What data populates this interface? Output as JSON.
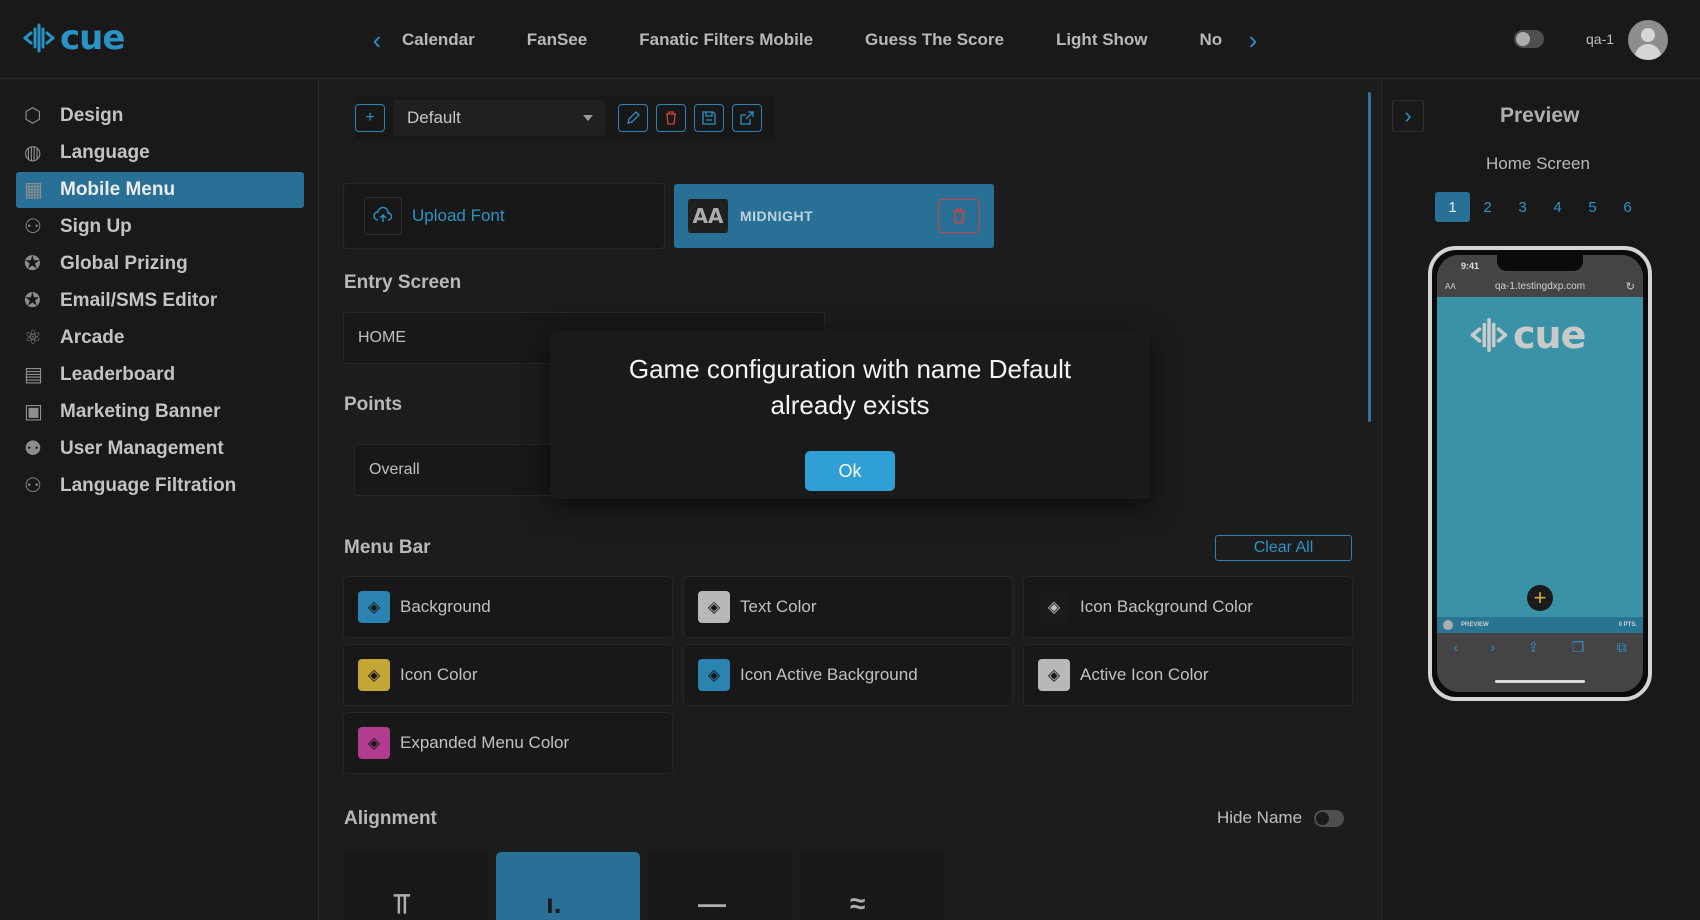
{
  "app": {
    "logo_text": "cue",
    "user_name": "qa-1"
  },
  "top_tabs": [
    "Calendar",
    "FanSee",
    "Fanatic Filters Mobile",
    "Guess The Score",
    "Light Show",
    "No"
  ],
  "sidebar": {
    "items": [
      {
        "label": "Design",
        "icon": "cube-icon"
      },
      {
        "label": "Language",
        "icon": "globe-icon"
      },
      {
        "label": "Mobile Menu",
        "icon": "grid-icon"
      },
      {
        "label": "Sign Up",
        "icon": "user-plus-icon"
      },
      {
        "label": "Global Prizing",
        "icon": "award-icon"
      },
      {
        "label": "Email/SMS Editor",
        "icon": "award-icon"
      },
      {
        "label": "Arcade",
        "icon": "atom-icon"
      },
      {
        "label": "Leaderboard",
        "icon": "chart-icon"
      },
      {
        "label": "Marketing Banner",
        "icon": "banner-icon"
      },
      {
        "label": "User Management",
        "icon": "users-icon"
      },
      {
        "label": "Language Filtration",
        "icon": "user-filter-icon"
      }
    ],
    "active_index": 2
  },
  "toolbar": {
    "config_select_value": "Default"
  },
  "fonts": {
    "upload_label": "Upload Font",
    "current_font_badge": "AA",
    "current_font_name": "MIDNIGHT"
  },
  "entry_screen": {
    "label": "Entry Screen",
    "value": "HOME"
  },
  "points": {
    "label": "Points",
    "value": "Overall"
  },
  "menu_bar": {
    "label": "Menu Bar",
    "clear_all": "Clear All",
    "colors": [
      {
        "label": "Background",
        "swatch": "#2f8fc0"
      },
      {
        "label": "Text Color",
        "swatch": "#c8c8c8"
      },
      {
        "label": "Icon Background Color",
        "swatch": "#1d1d1d"
      },
      {
        "label": "Icon Color",
        "swatch": "#d4b53a"
      },
      {
        "label": "Icon Active Background",
        "swatch": "#2f8fc0"
      },
      {
        "label": "Active Icon Color",
        "swatch": "#c8c8c8"
      },
      {
        "label": "Expanded Menu Color",
        "swatch": "#c0409a"
      }
    ]
  },
  "alignment": {
    "label": "Alignment",
    "hide_name_label": "Hide Name"
  },
  "preview": {
    "title": "Preview",
    "screen_name": "Home Screen",
    "pages": [
      "1",
      "2",
      "3",
      "4",
      "5",
      "6"
    ],
    "active_page": "1",
    "phone_time": "9:41",
    "phone_url": "qa-1.testingdxp.com",
    "phone_logo": "cue",
    "menu_left": "PREVIEW",
    "menu_right": "0 PTS."
  },
  "modal": {
    "message": "Game configuration with name Default already exists",
    "ok_label": "Ok"
  },
  "colors": {
    "accent": "#2f9fd6",
    "active_bg": "#2c7aa3",
    "danger": "#e04848"
  }
}
